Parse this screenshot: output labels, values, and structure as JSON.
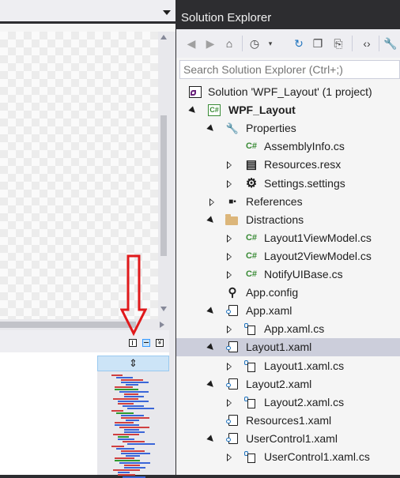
{
  "solution_explorer": {
    "title": "Solution Explorer",
    "search_placeholder": "Search Solution Explorer (Ctrl+;)",
    "toolbar_icons": [
      "back-icon",
      "forward-icon",
      "home-icon",
      "pending-changes-icon",
      "sync-icon",
      "collapse-all-icon",
      "show-all-files-icon",
      "view-code-icon",
      "properties-icon"
    ],
    "tree": [
      {
        "label": "Solution 'WPF_Layout' (1 project)",
        "icon": "solution-icon",
        "level": 0,
        "expander": "none"
      },
      {
        "label": "WPF_Layout",
        "icon": "csharp-project-icon",
        "level": 1,
        "expander": "open",
        "bold": true
      },
      {
        "label": "Properties",
        "icon": "wrench-icon",
        "level": 2,
        "expander": "open"
      },
      {
        "label": "AssemblyInfo.cs",
        "icon": "csharp-file-icon",
        "level": 3,
        "expander": "none"
      },
      {
        "label": "Resources.resx",
        "icon": "resource-file-icon",
        "level": 3,
        "expander": "closed"
      },
      {
        "label": "Settings.settings",
        "icon": "settings-gear-icon",
        "level": 3,
        "expander": "closed"
      },
      {
        "label": "References",
        "icon": "references-icon",
        "level": 2,
        "expander": "closed"
      },
      {
        "label": "Distractions",
        "icon": "folder-icon",
        "level": 2,
        "expander": "open"
      },
      {
        "label": "Layout1ViewModel.cs",
        "icon": "csharp-file-icon",
        "level": 3,
        "expander": "closed"
      },
      {
        "label": "Layout2ViewModel.cs",
        "icon": "csharp-file-icon",
        "level": 3,
        "expander": "closed"
      },
      {
        "label": "NotifyUIBase.cs",
        "icon": "csharp-file-icon",
        "level": 3,
        "expander": "closed"
      },
      {
        "label": "App.config",
        "icon": "config-file-icon",
        "level": 2,
        "expander": "none"
      },
      {
        "label": "App.xaml",
        "icon": "xaml-file-icon",
        "level": 2,
        "expander": "open"
      },
      {
        "label": "App.xaml.cs",
        "icon": "xaml-cs-file-icon",
        "level": 3,
        "expander": "closed"
      },
      {
        "label": "Layout1.xaml",
        "icon": "xaml-file-icon",
        "level": 2,
        "expander": "open",
        "selected": true
      },
      {
        "label": "Layout1.xaml.cs",
        "icon": "xaml-cs-file-icon",
        "level": 3,
        "expander": "closed"
      },
      {
        "label": "Layout2.xaml",
        "icon": "xaml-file-icon",
        "level": 2,
        "expander": "open"
      },
      {
        "label": "Layout2.xaml.cs",
        "icon": "xaml-cs-file-icon",
        "level": 3,
        "expander": "closed"
      },
      {
        "label": "Resources1.xaml",
        "icon": "xaml-file-icon",
        "level": 2,
        "expander": "none"
      },
      {
        "label": "UserControl1.xaml",
        "icon": "xaml-file-icon",
        "level": 2,
        "expander": "open"
      },
      {
        "label": "UserControl1.xaml.cs",
        "icon": "xaml-cs-file-icon",
        "level": 3,
        "expander": "closed"
      }
    ]
  },
  "designer": {
    "split_buttons": [
      "vertical-split-icon",
      "horizontal-split-icon",
      "collapse-pane-icon"
    ],
    "minimap_header_icon": "resize-splitter-icon",
    "annotation": "red-down-arrow",
    "colors": {
      "arrow": "#e0191b",
      "selection": "#cccedb",
      "accent": "#3399ff",
      "title_bar": "#2d2d30"
    }
  }
}
